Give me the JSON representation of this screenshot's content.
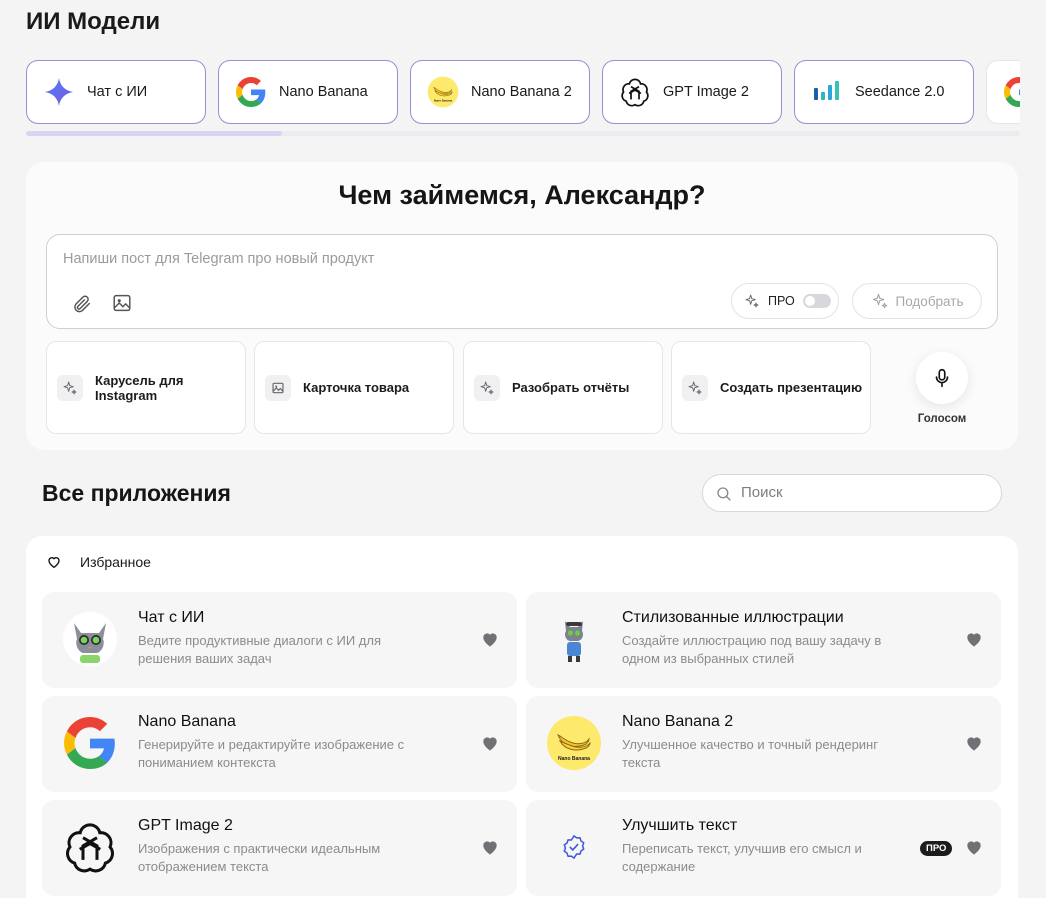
{
  "page_title": "ИИ Модели",
  "models": [
    {
      "label": "Чат с ИИ",
      "icon": "sparkle-icon"
    },
    {
      "label": "Nano Banana",
      "icon": "google-logo-icon"
    },
    {
      "label": "Nano Banana 2",
      "icon": "banana-icon"
    },
    {
      "label": "GPT Image 2",
      "icon": "openai-logo-icon"
    },
    {
      "label": "Seedance 2.0",
      "icon": "seedance-logo-icon"
    }
  ],
  "hero": {
    "title": "Чем займемся, Александр?",
    "prompt_placeholder": "Напиши пост для Telegram про новый продукт",
    "pro_label": "ПРО",
    "pick_label": "Подобрать",
    "voice_label": "Голосом"
  },
  "suggestions": [
    {
      "label": "Карусель для Instagram",
      "icon": "sparkle-icon"
    },
    {
      "label": "Карточка товара",
      "icon": "image-icon"
    },
    {
      "label": "Разобрать отчёты",
      "icon": "sparkle-icon"
    },
    {
      "label": "Создать презентацию",
      "icon": "sparkle-icon"
    }
  ],
  "apps": {
    "title": "Все приложения",
    "search_placeholder": "Поиск",
    "favorites_label": "Избранное",
    "items": [
      {
        "title": "Чат с ИИ",
        "desc": "Ведите продуктивные диалоги с ИИ для решения ваших задач",
        "icon": "cat-mascot-icon",
        "pro": ""
      },
      {
        "title": "Стилизованные иллюстрации",
        "desc": "Создайте иллюстрацию под вашу задачу в одном из выбранных стилей",
        "icon": "cat-artist-icon",
        "pro": ""
      },
      {
        "title": "Nano Banana",
        "desc": "Генерируйте и редактируйте изображение с пониманием контекста",
        "icon": "google-logo-icon",
        "pro": ""
      },
      {
        "title": "Nano Banana 2",
        "desc": "Улучшенное качество и точный рендеринг текста",
        "icon": "banana-icon",
        "pro": ""
      },
      {
        "title": "GPT Image 2",
        "desc": "Изображения с практически идеальным отображением текста",
        "icon": "openai-logo-icon",
        "pro": ""
      },
      {
        "title": "Улучшить текст",
        "desc": "Переписать текст, улучшив его смысл и содержание",
        "icon": "verified-badge-icon",
        "pro": "ПРО"
      }
    ]
  }
}
